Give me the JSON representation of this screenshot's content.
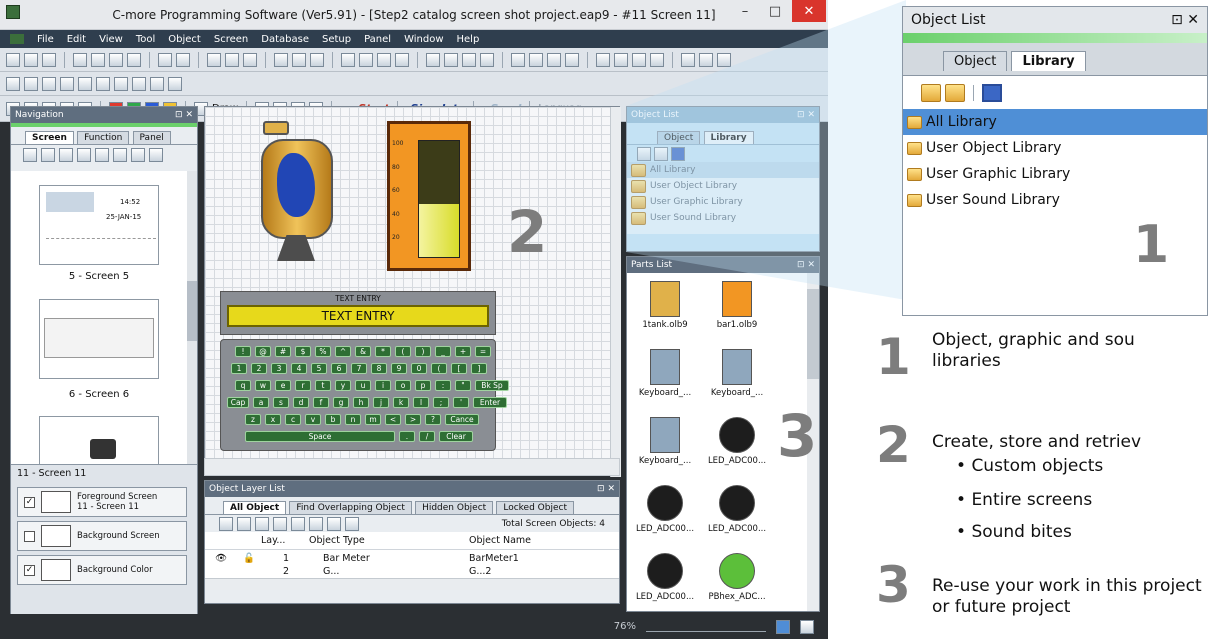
{
  "window": {
    "title": "C-more Programming Software (Ver5.91) - [Step2 catalog screen shot project.eap9 - #11 Screen 11]",
    "minimize": "–",
    "maximize": "□",
    "close": "✕"
  },
  "menu": [
    "File",
    "Edit",
    "View",
    "Tool",
    "Object",
    "Screen",
    "Database",
    "Setup",
    "Panel",
    "Window",
    "Help"
  ],
  "toolbar3": {
    "draw": "Draw",
    "start": "Start",
    "simulate": "Simulate",
    "send": "Send",
    "language": "Languag"
  },
  "navigation": {
    "title": "Navigation",
    "tabs": [
      "Screen",
      "Function",
      "Panel"
    ],
    "screens": [
      {
        "label": "5 - Screen 5",
        "time": "14:52",
        "date": "25-JAN-15"
      },
      {
        "label": "6 - Screen 6"
      }
    ],
    "current": "11 - Screen 11",
    "layers": [
      {
        "label": "Foreground Screen",
        "sub": "11 - Screen 11",
        "checked": true
      },
      {
        "label": "Background Screen",
        "checked": false
      },
      {
        "label": "Background Color",
        "checked": true
      }
    ]
  },
  "canvas": {
    "text_entry_title": "TEXT ENTRY",
    "text_entry_value": "TEXT ENTRY",
    "bar_ticks": [
      "100",
      "80",
      "60",
      "40",
      "20"
    ],
    "keys": [
      [
        "!",
        "@",
        "#",
        "$",
        "%",
        "^",
        "&",
        "*",
        "(",
        ")",
        "_",
        "+",
        "="
      ],
      [
        "1",
        "2",
        "3",
        "4",
        "5",
        "6",
        "7",
        "8",
        "9",
        "0",
        "(",
        "[",
        "]"
      ],
      [
        "q",
        "w",
        "e",
        "r",
        "t",
        "y",
        "u",
        "i",
        "o",
        "p",
        ":",
        "\"",
        "Bk Sp"
      ],
      [
        "Cap",
        "a",
        "s",
        "d",
        "f",
        "g",
        "h",
        "j",
        "k",
        "l",
        ";",
        "'",
        "Enter"
      ],
      [
        "z",
        "x",
        "c",
        "v",
        "b",
        "n",
        "m",
        "<",
        ">",
        "?",
        "Cance"
      ],
      [
        "Space",
        ".",
        "/",
        "Clear"
      ]
    ]
  },
  "layer_list": {
    "title": "Object Layer List",
    "tabs": [
      "All Object",
      "Find Overlapping Object",
      "Hidden Object",
      "Locked Object"
    ],
    "total": "Total Screen Objects: 4",
    "columns": [
      "Lay...",
      "Object Type",
      "Object Name"
    ],
    "rows": [
      {
        "layer": "1",
        "type": "Bar Meter",
        "name": "BarMeter1"
      },
      {
        "layer": "2",
        "type": "G...",
        "name": "G...2"
      }
    ]
  },
  "object_list_small": {
    "title": "Object List",
    "tabs": [
      "Object",
      "Library"
    ],
    "items": [
      "All Library",
      "User Object Library",
      "User Graphic Library",
      "User Sound Library"
    ]
  },
  "parts_list": {
    "title": "Parts List",
    "items": [
      "1tank.olb9",
      "bar1.olb9",
      "Keyboard_...",
      "Keyboard_...",
      "Keyboard_...",
      "LED_ADC00...",
      "LED_ADC00...",
      "LED_ADC00...",
      "LED_ADC00...",
      "PBhex_ADC..."
    ]
  },
  "statusbar": {
    "zoom": "76%"
  },
  "zoom_panel": {
    "title": "Object List",
    "tabs": [
      "Object",
      "Library"
    ],
    "items": [
      "All Library",
      "User Object Library",
      "User Graphic Library",
      "User Sound Library"
    ]
  },
  "callouts": [
    {
      "num": "1",
      "text": "Object, graphic and sou libraries",
      "items": []
    },
    {
      "num": "2",
      "text": "Create, store and retriev",
      "items": [
        "Custom objects",
        "Entire screens",
        "Sound bites"
      ]
    },
    {
      "num": "3",
      "text": "Re-use your work in this project or future project",
      "items": []
    }
  ],
  "canvas_num": "2",
  "parts_num": "3",
  "zoom_num": "1"
}
